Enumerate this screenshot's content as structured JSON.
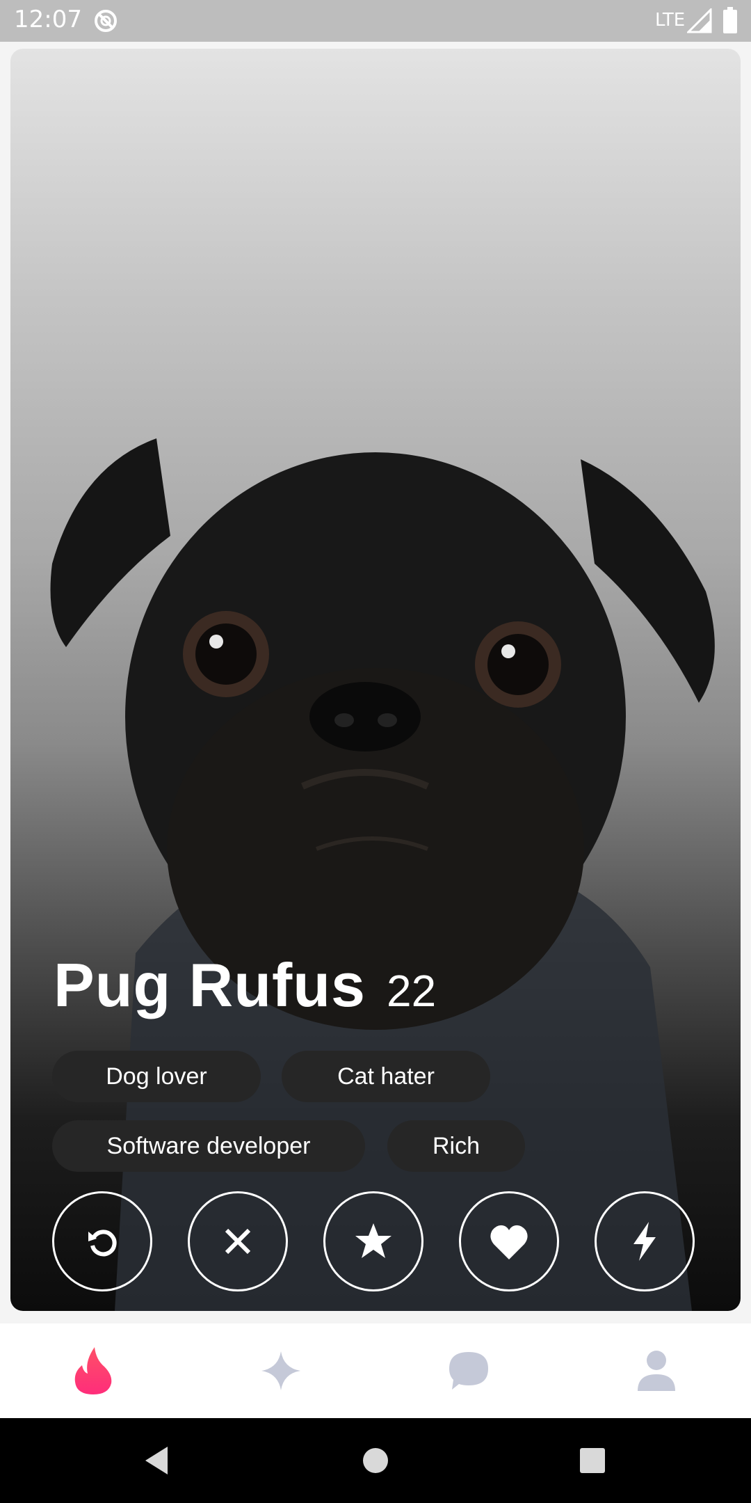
{
  "status_bar": {
    "time": "12:07",
    "network": "LTE",
    "icons": [
      "do-not-disturb-icon",
      "signal-icon",
      "battery-icon"
    ]
  },
  "profile": {
    "name": "Pug Rufus",
    "age": "22",
    "photo": "pug-photo",
    "tags": [
      "Dog lover",
      "Cat hater",
      "Software developer",
      "Rich"
    ]
  },
  "actions": [
    {
      "name": "rewind",
      "icon": "undo-icon"
    },
    {
      "name": "nope",
      "icon": "close-icon"
    },
    {
      "name": "super-like",
      "icon": "star-icon"
    },
    {
      "name": "like",
      "icon": "heart-icon"
    },
    {
      "name": "boost",
      "icon": "lightning-icon"
    }
  ],
  "bottom_nav": [
    {
      "name": "home",
      "icon": "flame-icon",
      "active": true
    },
    {
      "name": "explore",
      "icon": "sparkle-icon",
      "active": false
    },
    {
      "name": "messages",
      "icon": "chat-icon",
      "active": false
    },
    {
      "name": "profile",
      "icon": "user-icon",
      "active": false
    }
  ],
  "colors": {
    "accent": "#fd3a6f",
    "inactive_nav": "#c5c9d8",
    "chip_bg": "#262626"
  }
}
